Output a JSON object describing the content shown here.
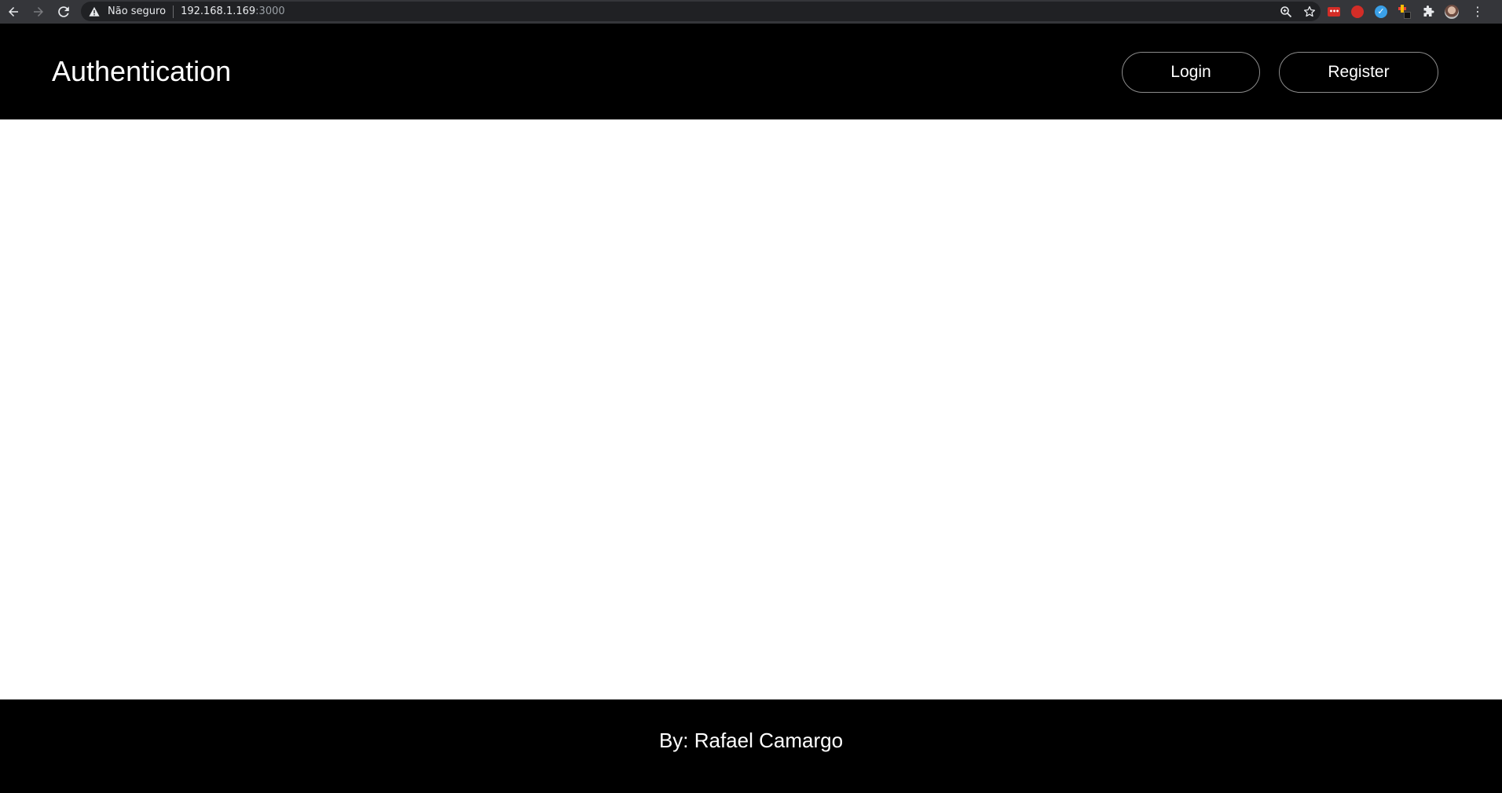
{
  "browser": {
    "security_label": "Não seguro",
    "url_host": "192.168.1.169",
    "url_port": ":3000",
    "icons": {
      "back": "back-arrow-icon",
      "forward": "forward-arrow-icon",
      "reload": "reload-icon",
      "warning": "warning-icon",
      "zoom": "zoom-icon",
      "bookmark": "star-icon",
      "extensions": "puzzle-icon",
      "menu": "kebab-menu-icon"
    }
  },
  "header": {
    "title": "Authentication",
    "login_label": "Login",
    "register_label": "Register"
  },
  "footer": {
    "credit": "By: Rafael Camargo"
  },
  "colors": {
    "header_bg": "#000000",
    "footer_bg": "#000000",
    "page_bg": "#ffffff",
    "text_on_dark": "#ffffff",
    "button_border": "#8c8c8c"
  }
}
